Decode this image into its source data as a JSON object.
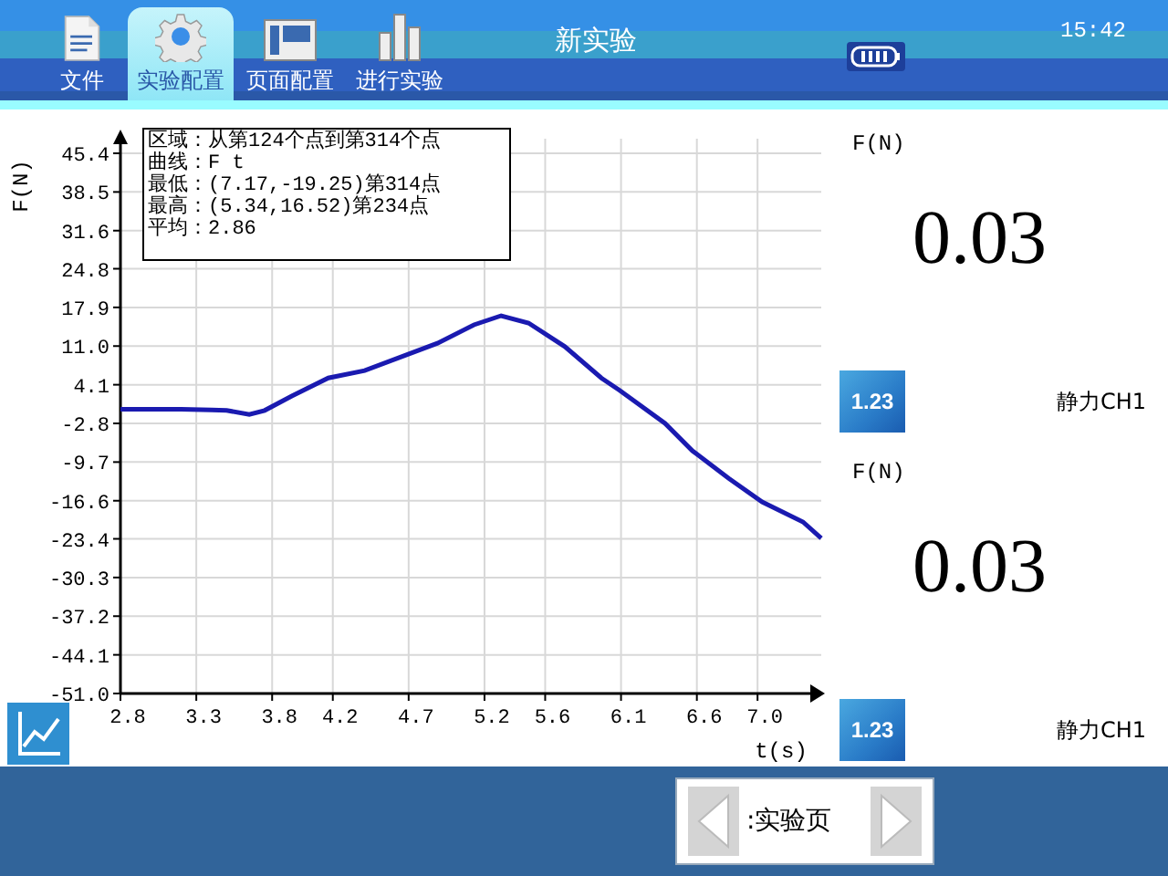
{
  "toolbar": {
    "tabs": [
      {
        "label": "文件",
        "kind": "file",
        "selected": false
      },
      {
        "label": "实验配置",
        "kind": "gear",
        "selected": true
      },
      {
        "label": "页面配置",
        "kind": "layout",
        "selected": false
      },
      {
        "label": "进行实验",
        "kind": "bars",
        "selected": false
      }
    ],
    "title": "新实验",
    "time": "15:42"
  },
  "graph": {
    "info": [
      "区域：从第124个点到第314个点",
      "曲线：F t",
      "最低：(7.17,-19.25)第314点",
      "最高：(5.34,16.52)第234点",
      "平均：2.86"
    ],
    "chart_data": {
      "type": "line",
      "xlabel": "t(s)",
      "ylabel": "F(N)",
      "x": [
        2.8,
        3.0,
        3.2,
        3.4,
        3.5,
        3.65,
        3.75,
        3.93,
        4.17,
        4.41,
        4.89,
        5.13,
        5.31,
        5.49,
        5.73,
        5.97,
        6.09,
        6.39,
        6.57,
        6.81,
        7.03,
        7.3,
        7.42
      ],
      "series": [
        {
          "color": "#1a1ab0",
          "values": [
            -0.3,
            -0.3,
            -0.3,
            -0.4,
            -0.5,
            -1.2,
            -0.5,
            2.1,
            5.3,
            6.6,
            11.5,
            14.8,
            16.4,
            15.1,
            10.9,
            5.3,
            3.1,
            -2.8,
            -7.7,
            -12.6,
            -16.8,
            -20.4,
            -23.3
          ]
        }
      ],
      "xlim": [
        2.8,
        7.42
      ],
      "ylim": [
        -51.0,
        45.4
      ],
      "grid": true,
      "xticks": [
        {
          "value": 2.8,
          "label": "2.8"
        },
        {
          "value": 3.3,
          "label": "3.3"
        },
        {
          "value": 3.8,
          "label": "3.8"
        },
        {
          "value": 4.2,
          "label": "4.2"
        },
        {
          "value": 4.7,
          "label": "4.7"
        },
        {
          "value": 5.2,
          "label": "5.2"
        },
        {
          "value": 5.6,
          "label": "5.6"
        },
        {
          "value": 6.1,
          "label": "6.1"
        },
        {
          "value": 6.6,
          "label": "6.6"
        },
        {
          "value": 7.0,
          "label": "7.0"
        }
      ],
      "yticks": [
        {
          "value": 45.4,
          "label": "45.4"
        },
        {
          "value": 38.5,
          "label": "38.5"
        },
        {
          "value": 31.6,
          "label": "31.6"
        },
        {
          "value": 24.8,
          "label": "24.8"
        },
        {
          "value": 17.9,
          "label": "17.9"
        },
        {
          "value": 11.0,
          "label": "11.0"
        },
        {
          "value": 4.1,
          "label": "4.1"
        },
        {
          "value": -2.8,
          "label": "-2.8"
        },
        {
          "value": -9.7,
          "label": "-9.7"
        },
        {
          "value": -16.6,
          "label": "-16.6"
        },
        {
          "value": -23.4,
          "label": "-23.4"
        },
        {
          "value": -30.3,
          "label": "-30.3"
        },
        {
          "value": -37.2,
          "label": "-37.2"
        },
        {
          "value": -44.1,
          "label": "-44.1"
        },
        {
          "value": -51.0,
          "label": "-51.0"
        }
      ]
    }
  },
  "meters": [
    {
      "unit": "F(N)",
      "value": "0.03",
      "badge": "1.23",
      "name": "静力CH1"
    },
    {
      "unit": "F(N)",
      "value": "0.03",
      "badge": "1.23",
      "name": "静力CH1"
    }
  ],
  "pager": {
    "label": ":实验页"
  }
}
